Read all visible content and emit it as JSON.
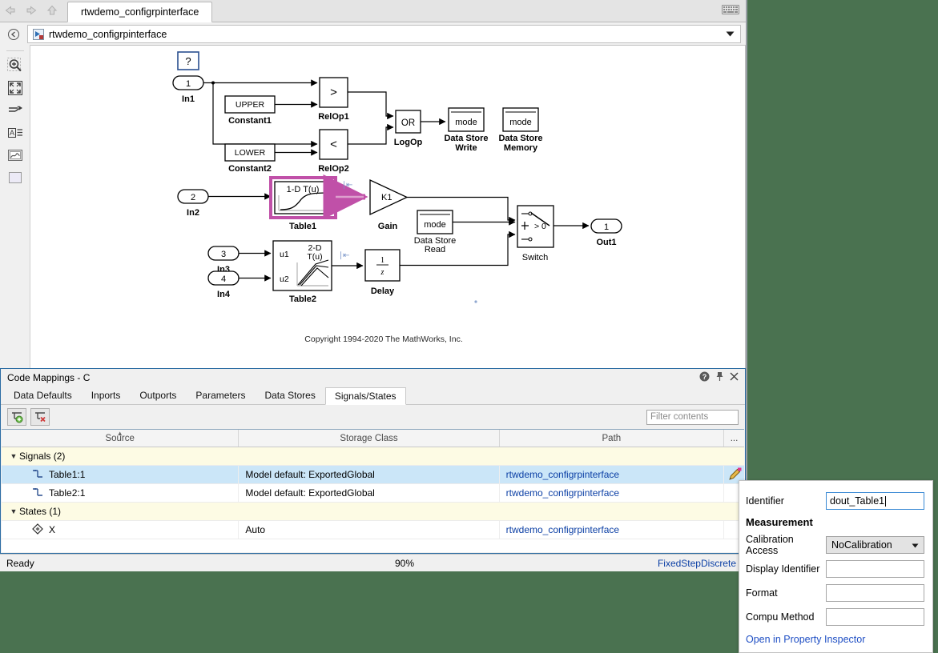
{
  "window": {
    "tab_label": "rtwdemo_configrpinterface",
    "address_text": "rtwdemo_configrpinterface",
    "nav": {
      "back": "back-arrow",
      "forward": "forward-arrow",
      "up": "up-arrow"
    },
    "keyboard_icon": "keyboard-icon"
  },
  "left_toolbar": {
    "items": [
      {
        "name": "navigate-back",
        "icon": "circle-left-arrow-icon"
      },
      {
        "name": "zoom",
        "icon": "magnifier-plus-icon"
      },
      {
        "name": "fit-to-view",
        "icon": "fit-to-view-icon"
      },
      {
        "name": "signal-lines",
        "icon": "signal-routing-icon"
      },
      {
        "name": "annotation",
        "icon": "text-annotation-icon"
      },
      {
        "name": "image",
        "icon": "image-icon"
      },
      {
        "name": "area",
        "icon": "area-rectangle-icon"
      },
      {
        "name": "snapshot",
        "icon": "camera-icon"
      },
      {
        "name": "layout",
        "icon": "layout-icon"
      },
      {
        "name": "more",
        "icon": "chevron-double-right-icon"
      }
    ]
  },
  "canvas": {
    "copyright": "Copyright 1994-2020 The MathWorks, Inc.",
    "help_block": "?",
    "blocks": [
      {
        "label": "In1",
        "port": "1",
        "type": "inport"
      },
      {
        "label": "In2",
        "port": "2",
        "type": "inport"
      },
      {
        "label": "In3",
        "port": "3",
        "type": "inport"
      },
      {
        "label": "In4",
        "port": "4",
        "type": "inport"
      },
      {
        "label": "Out1",
        "port": "1",
        "type": "outport"
      },
      {
        "label": "Constant1",
        "text": "UPPER",
        "type": "constant"
      },
      {
        "label": "Constant2",
        "text": "LOWER",
        "type": "constant"
      },
      {
        "label": "RelOp1",
        "text": ">",
        "type": "relop"
      },
      {
        "label": "RelOp2",
        "text": "<",
        "type": "relop"
      },
      {
        "label": "LogOp",
        "text": "OR",
        "type": "logop"
      },
      {
        "label": "Data Store Write",
        "text": "mode",
        "type": "datastore"
      },
      {
        "label": "Data Store Memory",
        "text": "mode",
        "type": "datastore"
      },
      {
        "label": "Data Store Read",
        "text": "mode",
        "type": "datastore"
      },
      {
        "label": "Table1",
        "text": "1-D T(u)",
        "type": "lookup1d",
        "selected": true
      },
      {
        "label": "Table2",
        "text": "2-D T(u)",
        "inputs": [
          "u1",
          "u2"
        ],
        "type": "lookup2d"
      },
      {
        "label": "Gain",
        "text": "K1",
        "type": "gain"
      },
      {
        "label": "Delay",
        "text": "1/z",
        "type": "delay"
      },
      {
        "label": "Switch",
        "text": "> 0",
        "type": "switch"
      }
    ]
  },
  "code_mappings": {
    "title": "Code Mappings - C",
    "title_buttons": [
      "help-icon",
      "pin-icon",
      "close-icon"
    ],
    "tabs": [
      {
        "label": "Data Defaults",
        "active": false
      },
      {
        "label": "Inports",
        "active": false
      },
      {
        "label": "Outports",
        "active": false
      },
      {
        "label": "Parameters",
        "active": false
      },
      {
        "label": "Data Stores",
        "active": false
      },
      {
        "label": "Signals/States",
        "active": true
      }
    ],
    "toolbar": {
      "add_button": "add-mapping-icon",
      "remove_button": "remove-mapping-icon",
      "filter_placeholder": "Filter contents"
    },
    "columns": [
      "Source",
      "Storage Class",
      "Path",
      "..."
    ],
    "groups": [
      {
        "label": "Signals (2)",
        "expanded": true,
        "rows": [
          {
            "source": "Table1:1",
            "storage_class": "Model default: ExportedGlobal",
            "path": "rtwdemo_configrpinterface",
            "selected": true,
            "has_edit_icon": true,
            "icon": "signal-icon"
          },
          {
            "source": "Table2:1",
            "storage_class": "Model default: ExportedGlobal",
            "path": "rtwdemo_configrpinterface",
            "selected": false,
            "has_edit_icon": false,
            "icon": "signal-icon"
          }
        ]
      },
      {
        "label": "States (1)",
        "expanded": true,
        "rows": [
          {
            "source": "X",
            "storage_class": "Auto",
            "path": "rtwdemo_configrpinterface",
            "selected": false,
            "has_edit_icon": false,
            "icon": "state-icon"
          }
        ]
      }
    ]
  },
  "status_bar": {
    "ready": "Ready",
    "zoom": "90%",
    "solver": "FixedStepDiscrete"
  },
  "property_popup": {
    "identifier_label": "Identifier",
    "identifier_value": "dout_Table1",
    "section_title": "Measurement",
    "calibration_label": "Calibration Access",
    "calibration_value": "NoCalibration",
    "display_identifier_label": "Display Identifier",
    "display_identifier_value": "",
    "format_label": "Format",
    "format_value": "",
    "compu_method_label": "Compu Method",
    "compu_method_value": "",
    "link_label": "Open in Property Inspector"
  },
  "colors": {
    "desktop": "#4a7250",
    "selection": "#cbe6f8",
    "group_row": "#fdfbe4",
    "link": "#0b3fa5",
    "highlight_signal": "#c050a8",
    "panel_border": "#2b6ca3"
  }
}
